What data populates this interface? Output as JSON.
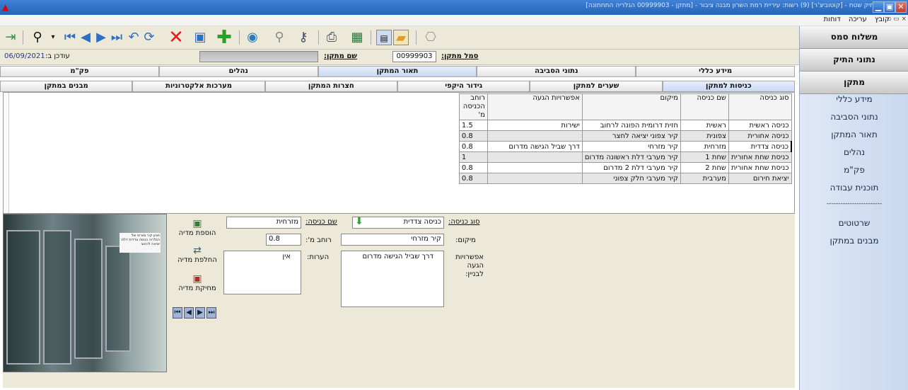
{
  "window": {
    "title": "תיק שטח - [קוטוביצ'ר] (9) רשות: עיריית רמת השרון מבנה ציבור - [מתקן - 00999903 הגלריה התחתונה]",
    "icon": "app-icon",
    "controls": [
      "minimize-icon",
      "restore-icon",
      "close-icon"
    ]
  },
  "menu": {
    "items": [
      "קובץ",
      "עריכה",
      "דוחות"
    ],
    "mini": "▫ ▭ ×"
  },
  "toolbar": [
    "exit-icon",
    "binoculars-icon",
    "first-icon",
    "prev-icon",
    "next-icon",
    "last-icon",
    "undo-icon",
    "refresh-icon",
    "delete-icon",
    "save-icon",
    "add-icon",
    "globe-icon",
    "search-icon",
    "key-icon",
    "print-icon",
    "excel-icon",
    "form-view-icon",
    "folder-icon",
    "camera-icon"
  ],
  "info": {
    "facility_code_label": "סמל מתקן:",
    "facility_code": "00999903",
    "facility_name_label": "שם מתקן:",
    "facility_name": "",
    "updated_label": "עודכן ב:",
    "updated": "06/09/2021"
  },
  "tabs_row1": [
    "מידע כללי",
    "נתוני הסביבה",
    "תאור המתקן",
    "נהלים",
    "פק\"מ"
  ],
  "tabs_row1_active": 2,
  "tabs_row2": [
    "כניסות למתקן",
    "שערים למתקן",
    "גידור היקפי",
    "חצרות המתקן",
    "מערכות אלקטרוניות",
    "מבנים במתקן"
  ],
  "tabs_row2_active": 0,
  "grid": {
    "headers": [
      "סוג כניסה",
      "שם כניסה",
      "מיקום",
      "אפשרויות הגעה",
      "רוחב הכניסה מ'"
    ],
    "rows": [
      [
        "כניסה ראשית",
        "ראשית",
        "חזית דרומית הפונה לרחוב",
        "ישירות",
        "1.5"
      ],
      [
        "כניסה אחורית",
        "צפונית",
        "קיר צפוני יציאה לחצר",
        "",
        "0.8"
      ],
      [
        "כניסה צדדית",
        "מזרחית",
        "קיר מזרחי",
        "דרך שביל הגישה מדרום",
        "0.8"
      ],
      [
        "כניסת שחת אחורית",
        "שחת 1",
        "קיר מערבי דלת ראשונה מדרום",
        "",
        "1"
      ],
      [
        "כניסת שחת אחורית",
        "שחת 2",
        "קיר מערבי דלת 2 מדרום",
        "",
        "0.8"
      ],
      [
        "יציאת חירום",
        "מערבית",
        "קיר מערבי חלק צפוני",
        "",
        "0.8"
      ]
    ],
    "selected_row": 2
  },
  "form": {
    "type_label": "סוג כניסה:",
    "type_value": "כניסה צדדית",
    "name_label": "שם כניסה:",
    "name_value": "מזרחית",
    "location_label": "מיקום:",
    "location_value": "קיר מזרחי",
    "width_label": "רוחב מ':",
    "width_value": "0.8",
    "access_label": "אפשרויות הגעה לבניין:",
    "access_value": "דרך שביל הגישה מדרום",
    "notes_label": "הערות:",
    "notes_value": "אין"
  },
  "media": {
    "add": "הוספת מדיה",
    "replace": "החלפת מדיה",
    "delete": "מחיקת מדיה"
  },
  "photo": {
    "sign_text": "חניון קיר מזרחי של הגלריה כניסה צדדית דלת יציאה לרחוב"
  },
  "sidebar": {
    "sections": [
      "משלוח סמס",
      "נתוני התיק",
      "מתקן"
    ],
    "items": [
      "מידע כללי",
      "נתוני הסביבה",
      "תאור המתקן",
      "נהלים",
      "פק\"מ",
      "תוכנית עבודה",
      "------------------------",
      "שרטוטים",
      "מבנים במתקן"
    ]
  }
}
